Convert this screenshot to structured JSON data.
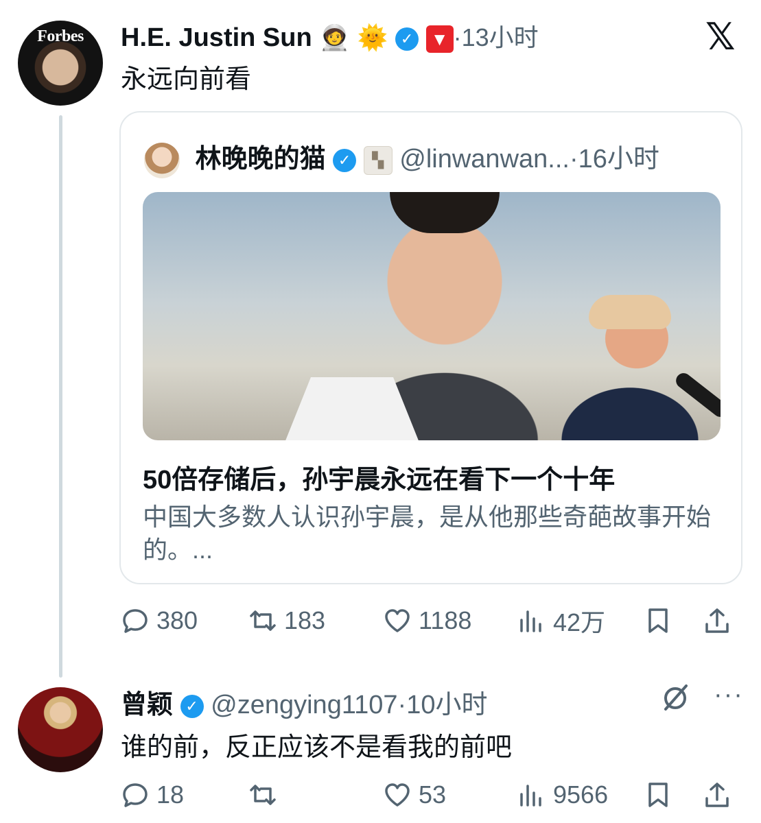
{
  "main_tweet": {
    "author_name": "H.E. Justin Sun",
    "emojis": [
      "🧑‍🚀",
      "🌞"
    ],
    "tron_badge": "▼",
    "time": "·13小时",
    "text": "永远向前看",
    "avatar_text": "Forbes"
  },
  "quote": {
    "author_name": "林晚晚的猫",
    "badge_icon": "▚",
    "handle": "@linwanwan...",
    "time": "·16小时",
    "article_title": "50倍存储后，孙宇晨永远在看下一个十年",
    "article_desc": "中国大多数人认识孙宇晨，是从他那些奇葩故事开始的。..."
  },
  "main_stats": {
    "replies": "380",
    "retweets": "183",
    "likes": "1188",
    "views": "42万"
  },
  "reply": {
    "author_name": "曾颖",
    "handle": "@zengying1107",
    "time": "·10小时",
    "text": "谁的前，反正应该不是看我的前吧",
    "more": "···"
  },
  "reply_stats": {
    "replies": "18",
    "retweets": "",
    "likes": "53",
    "views": "9566"
  },
  "icons": {
    "x_logo": "𝕏",
    "verified": "✓"
  },
  "colors": {
    "verified": "#1d9bf0",
    "muted": "#536471",
    "tron": "#e8242a"
  }
}
